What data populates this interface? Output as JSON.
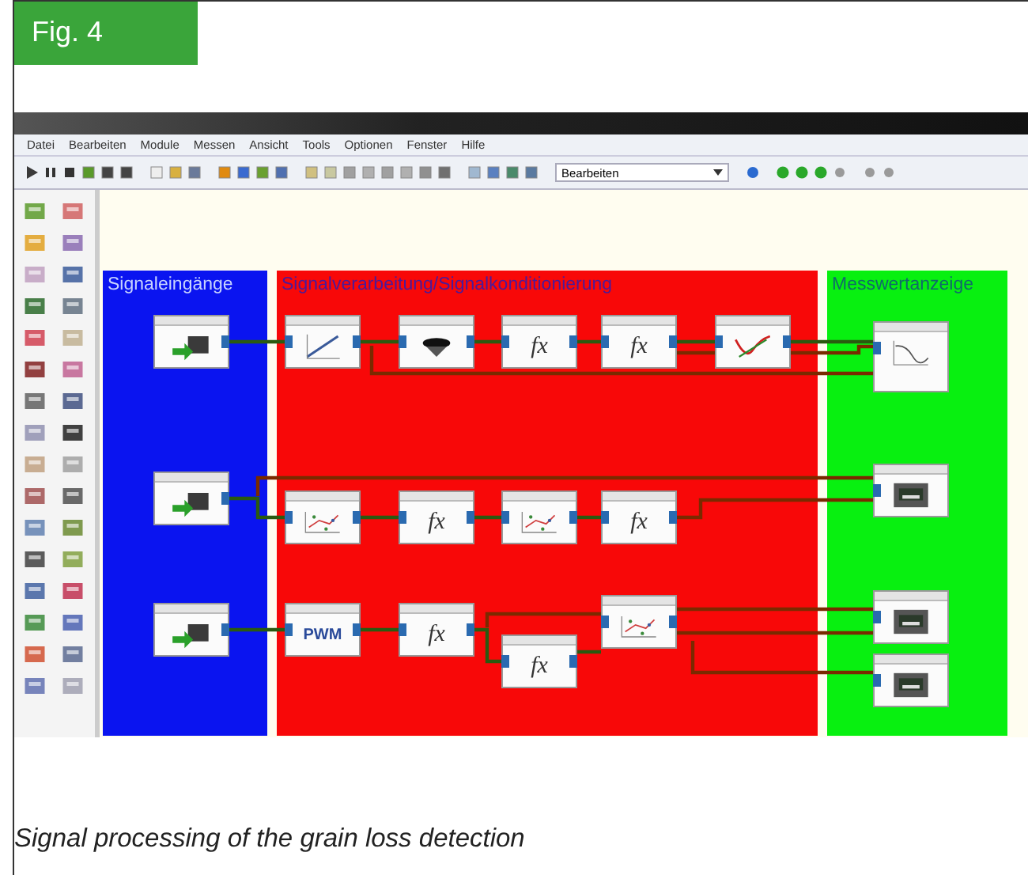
{
  "figure_label": "Fig. 4",
  "menu": [
    "Datei",
    "Bearbeiten",
    "Module",
    "Messen",
    "Ansicht",
    "Tools",
    "Optionen",
    "Fenster",
    "Hilfe"
  ],
  "toolbar": {
    "mode_dropdown": "Bearbeiten"
  },
  "sections": [
    {
      "title": "Signaleingänge",
      "color": "#0a14f0",
      "blocks": [
        {
          "kind": "input"
        },
        {
          "kind": "input"
        },
        {
          "kind": "input"
        }
      ]
    },
    {
      "title": "Signalverarbeitung/Signalkonditionierung",
      "color": "#f80808",
      "blocks": [
        {
          "kind": "ramp"
        },
        {
          "kind": "filter"
        },
        {
          "kind": "fx",
          "symbol": "fx"
        },
        {
          "kind": "fx",
          "symbol": "fx"
        },
        {
          "kind": "curve"
        },
        {
          "kind": "scatter"
        },
        {
          "kind": "fx",
          "symbol": "fx"
        },
        {
          "kind": "scatter"
        },
        {
          "kind": "fx",
          "symbol": "fx"
        },
        {
          "kind": "pwm",
          "symbol": "PWM"
        },
        {
          "kind": "fx",
          "symbol": "fx"
        },
        {
          "kind": "fx",
          "symbol": "fx"
        },
        {
          "kind": "scatter"
        }
      ]
    },
    {
      "title": "Messwertanzeige",
      "color": "#08f010",
      "blocks": [
        {
          "kind": "plot"
        },
        {
          "kind": "display"
        },
        {
          "kind": "display"
        },
        {
          "kind": "display"
        }
      ]
    }
  ],
  "caption": "Signal processing of the grain loss detection"
}
